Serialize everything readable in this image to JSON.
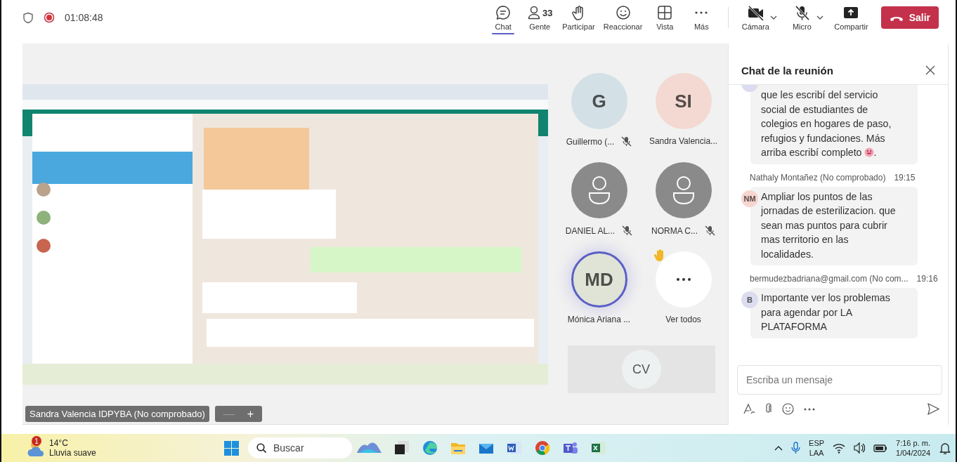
{
  "meeting": {
    "recording": true,
    "elapsed": "01:08:48"
  },
  "toolbar": [
    {
      "kind": "chat",
      "label": "Chat",
      "selected": true
    },
    {
      "kind": "people",
      "label": "Gente",
      "count": "33",
      "selected": false
    },
    {
      "kind": "hand",
      "label": "Participar",
      "selected": false
    },
    {
      "kind": "react",
      "label": "Reaccionar",
      "selected": false
    },
    {
      "kind": "view",
      "label": "Vista",
      "selected": false
    },
    {
      "kind": "more",
      "label": "Más",
      "selected": false
    }
  ],
  "devices": [
    {
      "kind": "camera",
      "label": "Cámara",
      "off": true
    },
    {
      "kind": "mic",
      "label": "Micro",
      "off": true
    },
    {
      "kind": "share",
      "label": "Compartir"
    }
  ],
  "leave_button": "Salir",
  "stage": {
    "kind": "picture",
    "presenter": "Sandra Valencia IDPYBA (No comprobado)",
    "zoom": [
      {
        "symbol": "—",
        "disabled": true
      },
      {
        "symbol": "+",
        "disabled": false
      }
    ]
  },
  "participants": [
    {
      "kind": "initials",
      "initials": "G",
      "name": "Guillermo (...",
      "muted": true,
      "color": "#d3e0e6"
    },
    {
      "kind": "initials",
      "initials": "SI",
      "name": "Sandra Valencia...",
      "muted": false,
      "color": "#f3d9d1"
    },
    {
      "kind": "generic",
      "name": "DANIEL AL...",
      "muted": true
    },
    {
      "kind": "generic",
      "name": "NORMA C...",
      "muted": true
    },
    {
      "kind": "initials",
      "initials": "MD",
      "name": "Mónica Ariana ...",
      "muted": false,
      "speaking": true,
      "color": "#dfe4d6"
    },
    {
      "kind": "more",
      "name": "Ver todos",
      "raised_hand": true
    }
  ],
  "self_view": {
    "initials": "CV"
  },
  "chat": {
    "title": "Chat de la reunión",
    "messages": [
      {
        "color": "#dcdcf0",
        "text": "que les escribí del servicio social de estudiantes de colegios en hogares de paso, refugios y fundaciones. Más arriba escribí completo",
        "emoji": true,
        "tail": "."
      },
      {
        "author": "Nathaly Montañez (No comprobado)",
        "time": "19:15",
        "initials": "NM",
        "color": "#f6d5d0",
        "text": "Ampliar los puntos de las jornadas de esterilizacion. que sean mas puntos para cubrir mas territorio en las localidades."
      },
      {
        "author": "bermudezbadriana@gmail.com (No com...",
        "time": "19:16",
        "initials": "B",
        "color": "#dcdcf0",
        "text": "Importante ver los problemas para agendar por LA PLATAFORMA"
      }
    ],
    "placeholder": "Escriba un mensaje"
  },
  "taskbar": {
    "weather": {
      "badge": "1",
      "temperature": "14°C",
      "condition": "Lluvia suave"
    },
    "search": "Buscar",
    "apps": [
      {
        "kind": "widget"
      },
      {
        "kind": "taskview"
      },
      {
        "kind": "edge"
      },
      {
        "kind": "folder"
      },
      {
        "kind": "mail"
      },
      {
        "kind": "word"
      },
      {
        "kind": "chrome"
      },
      {
        "kind": "teams"
      },
      {
        "kind": "excel"
      }
    ],
    "language": "ESP",
    "layout": "LAA",
    "time": "7:16 p. m.",
    "date": "1/04/2024"
  }
}
